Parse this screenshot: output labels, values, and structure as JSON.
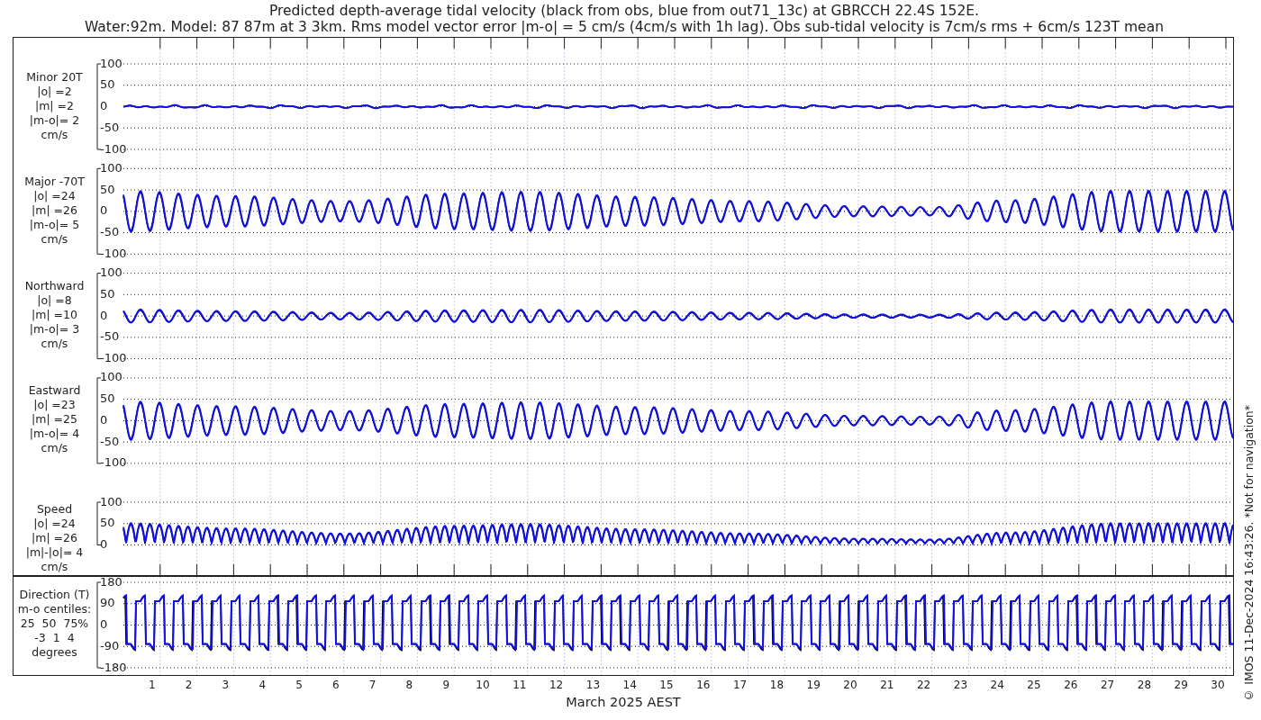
{
  "title_lines": [
    "Predicted depth-average tidal velocity (black from obs, blue from out71_13c) at GBRCCH 22.4S 152E.",
    "Water:92m. Model: 87 87m at 3 3km. Rms model vector error |m-o| = 5 cm/s (4cm/s with 1h lag). Obs sub-tidal velocity is 7cm/s rms + 6cm/s 123T mean"
  ],
  "panels": [
    {
      "kind": "minor",
      "label_lines": [
        "Minor 20T",
        "|o| =2",
        "|m| =2",
        "|m-o|= 2",
        "cm/s"
      ],
      "yticks": [
        "100",
        "50",
        "0",
        "-50",
        "-100"
      ]
    },
    {
      "kind": "major",
      "label_lines": [
        "Major -70T",
        "|o| =24",
        "|m| =26",
        "|m-o|= 5",
        "cm/s"
      ],
      "yticks": [
        "100",
        "50",
        "0",
        "-50",
        "-100"
      ]
    },
    {
      "kind": "northward",
      "label_lines": [
        "Northward",
        "|o| =8",
        "|m| =10",
        "|m-o|= 3",
        "cm/s"
      ],
      "yticks": [
        "100",
        "50",
        "0",
        "-50",
        "-100"
      ]
    },
    {
      "kind": "eastward",
      "label_lines": [
        "Eastward",
        "|o| =23",
        "|m| =25",
        "|m-o|= 4",
        "cm/s"
      ],
      "yticks": [
        "100",
        "50",
        "0",
        "-50",
        "-100"
      ]
    },
    {
      "kind": "speed",
      "label_lines": [
        "Speed",
        "|o| =24",
        "|m| =26",
        "|m|-|o|= 4",
        "cm/s"
      ],
      "yticks": [
        "100",
        "50",
        "0"
      ]
    },
    {
      "kind": "direction",
      "label_lines": [
        "Direction (T)",
        "m-o centiles:",
        "25  50  75%",
        "-3  1  4",
        "degrees"
      ],
      "yticks": [
        "180",
        "90",
        "0",
        "-90",
        "-180"
      ]
    }
  ],
  "x_axis": {
    "day_labels": [
      "1",
      "2",
      "3",
      "4",
      "5",
      "6",
      "7",
      "8",
      "9",
      "10",
      "11",
      "12",
      "13",
      "14",
      "15",
      "16",
      "17",
      "18",
      "19",
      "20",
      "21",
      "22",
      "23",
      "24",
      "25",
      "26",
      "27",
      "28",
      "29",
      "30"
    ],
    "label": "March 2025 AEST"
  },
  "footer_note": "© IMOS 11-Dec-2024 16:43:26. *Not for navigation*"
}
